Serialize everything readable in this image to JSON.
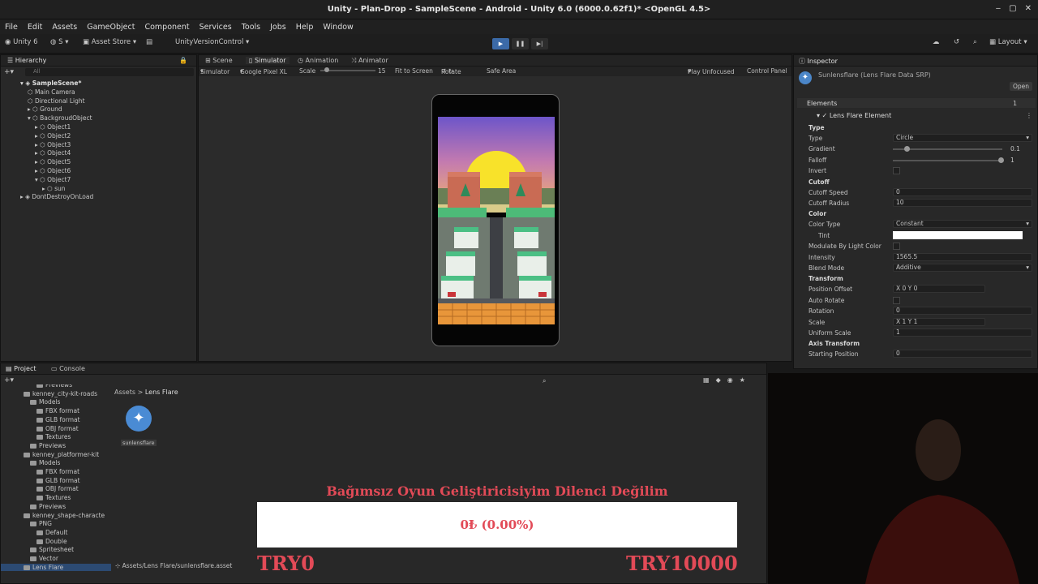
{
  "window": {
    "title": "Unity - Plan-Drop - SampleScene - Android - Unity 6.0 (6000.0.62f1)* <OpenGL 4.5>"
  },
  "menu": [
    "File",
    "Edit",
    "Assets",
    "GameObject",
    "Component",
    "Services",
    "Tools",
    "Jobs",
    "Help",
    "Window"
  ],
  "toolbar": {
    "account": "Unity 6",
    "user": "S",
    "asset_store": "Asset Store",
    "vcs": "UnityVersionControl",
    "layout": "Layout"
  },
  "hierarchy": {
    "tab": "Hierarchy",
    "search_placeholder": "All",
    "items": [
      {
        "label": "SampleScene*",
        "bold": true
      },
      {
        "label": "Main Camera"
      },
      {
        "label": "Directional Light"
      },
      {
        "label": "Ground"
      },
      {
        "label": "BackgroudObject"
      },
      {
        "label": "Object1"
      },
      {
        "label": "Object2"
      },
      {
        "label": "Object3"
      },
      {
        "label": "Object4"
      },
      {
        "label": "Object5"
      },
      {
        "label": "Object6"
      },
      {
        "label": "Object7"
      },
      {
        "label": "sun"
      },
      {
        "label": "DontDestroyOnLoad"
      }
    ]
  },
  "center": {
    "tabs": [
      "Scene",
      "Simulator",
      "Animation",
      "Animator"
    ],
    "sim": {
      "mode": "Simulator",
      "device": "Google Pixel XL",
      "scale_label": "Scale",
      "scale_value": "15",
      "fit": "Fit to Screen",
      "rotate": "Rotate",
      "safe_area": "Safe Area",
      "play_mode": "Play Unfocused",
      "control_panel": "Control Panel"
    }
  },
  "inspector": {
    "tab": "Inspector",
    "object": "Sunlensflare (Lens Flare Data SRP)",
    "open": "Open",
    "elements_label": "Elements",
    "elements_count": "1",
    "element_name": "Lens Flare Element",
    "rows": [
      {
        "label": "Type",
        "section": true
      },
      {
        "label": "Type",
        "value": "Circle"
      },
      {
        "label": "Gradient",
        "value": "0.1"
      },
      {
        "label": "Falloff",
        "value": "1"
      },
      {
        "label": "Invert",
        "value": ""
      },
      {
        "label": "Cutoff",
        "section": true
      },
      {
        "label": "Cutoff Speed",
        "value": "0"
      },
      {
        "label": "Cutoff Radius",
        "value": "10"
      },
      {
        "label": "Color",
        "section": true
      },
      {
        "label": "Color Type",
        "value": "Constant"
      },
      {
        "label": "Tint",
        "value": ""
      },
      {
        "label": "Modulate By Light Color",
        "value": ""
      },
      {
        "label": "Intensity",
        "value": "1565.5"
      },
      {
        "label": "Blend Mode",
        "value": "Additive"
      },
      {
        "label": "Transform",
        "section": true
      },
      {
        "label": "Position Offset",
        "value": "X 0    Y 0"
      },
      {
        "label": "Auto Rotate",
        "value": ""
      },
      {
        "label": "Rotation",
        "value": "0"
      },
      {
        "label": "Scale",
        "value": "X 1    Y 1"
      },
      {
        "label": "Uniform Scale",
        "value": "1"
      },
      {
        "label": "Axis Transform",
        "section": true
      },
      {
        "label": "Starting Position",
        "value": "0"
      }
    ]
  },
  "project": {
    "tabs": [
      "Project",
      "Console"
    ],
    "tree": [
      {
        "label": "Previews",
        "indent": 3
      },
      {
        "label": "kenney_city-kit-roads",
        "indent": 1
      },
      {
        "label": "Models",
        "indent": 2
      },
      {
        "label": "FBX format",
        "indent": 3
      },
      {
        "label": "GLB format",
        "indent": 3
      },
      {
        "label": "OBJ format",
        "indent": 3
      },
      {
        "label": "Textures",
        "indent": 3
      },
      {
        "label": "Previews",
        "indent": 2
      },
      {
        "label": "kenney_platformer-kit",
        "indent": 1
      },
      {
        "label": "Models",
        "indent": 2
      },
      {
        "label": "FBX format",
        "indent": 3
      },
      {
        "label": "GLB format",
        "indent": 3
      },
      {
        "label": "OBJ format",
        "indent": 3
      },
      {
        "label": "Textures",
        "indent": 3
      },
      {
        "label": "Previews",
        "indent": 2
      },
      {
        "label": "kenney_shape-characte",
        "indent": 1
      },
      {
        "label": "PNG",
        "indent": 2
      },
      {
        "label": "Default",
        "indent": 3
      },
      {
        "label": "Double",
        "indent": 3
      },
      {
        "label": "Spritesheet",
        "indent": 2
      },
      {
        "label": "Vector",
        "indent": 2
      },
      {
        "label": "Lens Flare",
        "indent": 1
      }
    ],
    "breadcrumb": [
      "Assets",
      "Lens Flare"
    ],
    "asset_name": "sunlensflare",
    "status_path": "Assets/Lens Flare/sunlensflare.asset"
  },
  "overlay": {
    "title": "Bağımsız Oyun Geliştiricisiyim Dilenci Değilim",
    "amount": "0₺ (0.00%)",
    "min": "TRY0",
    "max": "TRY10000",
    "progress_percent": 0
  },
  "colors": {
    "accent": "#3b6aa8",
    "overlay_text": "#e24a57"
  }
}
